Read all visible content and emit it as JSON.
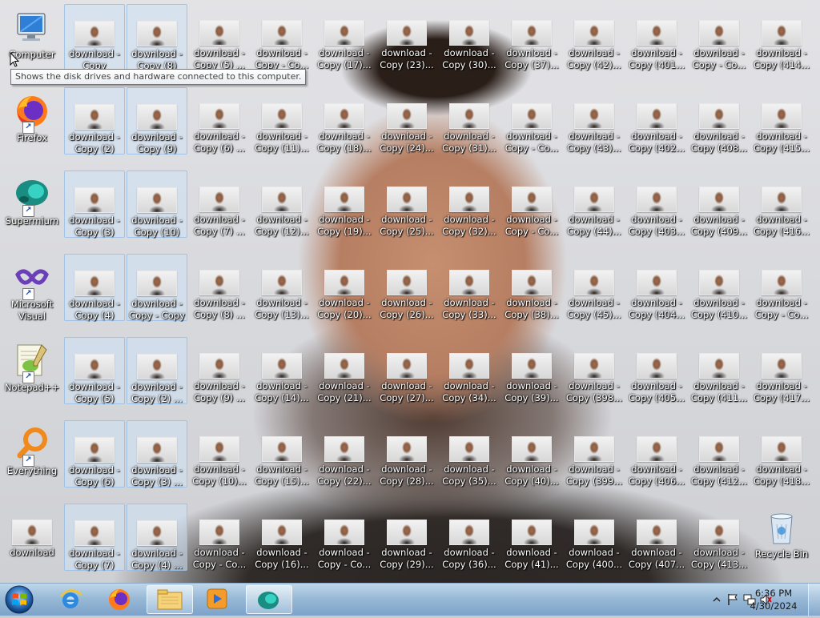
{
  "desktop": {
    "system_icons": [
      {
        "label": "Computer",
        "icon": "computer-icon"
      },
      {
        "label": "Firefox",
        "icon": "firefox-icon"
      },
      {
        "label": "Supermium",
        "icon": "supermium-icon"
      },
      {
        "label": "Microsoft Visual Studi...",
        "icon": "visual-studio-icon"
      },
      {
        "label": "Notepad++",
        "icon": "notepad-plus-plus-icon"
      },
      {
        "label": "Everything",
        "icon": "everything-icon"
      },
      {
        "label": "download",
        "icon": "image-file-icon"
      }
    ],
    "file_columns": [
      [
        "download - Copy",
        "download - Copy (2)",
        "download - Copy (3)",
        "download - Copy (4)",
        "download - Copy (5)",
        "download - Copy (6)",
        "download - Copy (7)"
      ],
      [
        "download - Copy (8)",
        "download - Copy (9)",
        "download - Copy (10)",
        "download - Copy - Copy",
        "download - Copy (2) ...",
        "download - Copy (3) ...",
        "download - Copy (4) ..."
      ],
      [
        "download - Copy (5) ...",
        "download - Copy (6) ...",
        "download - Copy (7) ...",
        "download - Copy (8) ...",
        "download - Copy (9) ...",
        "download - Copy (10)...",
        "download - Copy - Co..."
      ],
      [
        "download - Copy - Co...",
        "download - Copy (11)...",
        "download - Copy (12)...",
        "download - Copy (13)...",
        "download - Copy (14)...",
        "download - Copy (15)...",
        "download - Copy (16)..."
      ],
      [
        "download - Copy (17)...",
        "download - Copy (18)...",
        "download - Copy (19)...",
        "download - Copy (20)...",
        "download - Copy (21)...",
        "download - Copy (22)...",
        "download - Copy - Co..."
      ],
      [
        "download - Copy (23)...",
        "download - Copy (24)...",
        "download - Copy (25)...",
        "download - Copy (26)...",
        "download - Copy (27)...",
        "download - Copy (28)...",
        "download - Copy (29)..."
      ],
      [
        "download - Copy (30)...",
        "download - Copy (31)...",
        "download - Copy (32)...",
        "download - Copy (33)...",
        "download - Copy (34)...",
        "download - Copy (35)...",
        "download - Copy (36)..."
      ],
      [
        "download - Copy (37)...",
        "download - Copy - Co...",
        "download - Copy - Co...",
        "download - Copy (38)...",
        "download - Copy (39)...",
        "download - Copy (40)...",
        "download - Copy (41)..."
      ],
      [
        "download - Copy (42)...",
        "download - Copy (43)...",
        "download - Copy (44)...",
        "download - Copy (45)...",
        "download - Copy (398...",
        "download - Copy (399...",
        "download - Copy (400..."
      ],
      [
        "download - Copy (401...",
        "download - Copy (402...",
        "download - Copy (403...",
        "download - Copy (404...",
        "download - Copy (405...",
        "download - Copy (406...",
        "download - Copy (407..."
      ],
      [
        "download - Copy - Co...",
        "download - Copy (408...",
        "download - Copy (409...",
        "download - Copy (410...",
        "download - Copy (411...",
        "download - Copy (412...",
        "download - Copy (413..."
      ],
      [
        "download - Copy (414...",
        "download - Copy (415...",
        "download - Copy (416...",
        "download - Copy - Co...",
        "download - Copy (417...",
        "download - Copy (418...",
        "Recycle Bin"
      ]
    ],
    "selected_columns": [
      0,
      1
    ]
  },
  "tooltip": {
    "text": "Shows the disk drives and hardware connected to this computer."
  },
  "taskbar": {
    "pinned": [
      {
        "name": "internet-explorer-icon",
        "active": false
      },
      {
        "name": "firefox-icon",
        "active": false
      },
      {
        "name": "file-explorer-icon",
        "active": true
      },
      {
        "name": "media-player-icon",
        "active": false
      },
      {
        "name": "supermium-icon",
        "active": true
      }
    ],
    "clock": {
      "time": "6:36 PM",
      "date": "4/30/2024"
    }
  },
  "colors": {
    "selection": "#cde1f5",
    "taskbar": "#8fb4d6",
    "label_text": "#ffffff"
  }
}
